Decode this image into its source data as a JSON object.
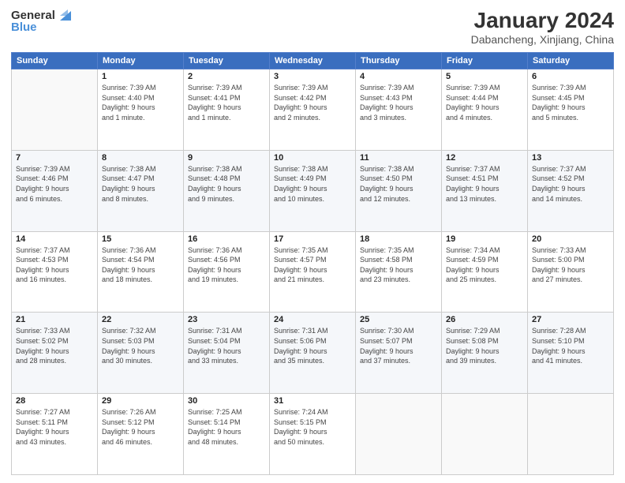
{
  "logo": {
    "line1": "General",
    "line2": "Blue"
  },
  "header": {
    "month": "January 2024",
    "location": "Dabancheng, Xinjiang, China"
  },
  "weekdays": [
    "Sunday",
    "Monday",
    "Tuesday",
    "Wednesday",
    "Thursday",
    "Friday",
    "Saturday"
  ],
  "weeks": [
    [
      {
        "day": "",
        "info": ""
      },
      {
        "day": "1",
        "info": "Sunrise: 7:39 AM\nSunset: 4:40 PM\nDaylight: 9 hours\nand 1 minute."
      },
      {
        "day": "2",
        "info": "Sunrise: 7:39 AM\nSunset: 4:41 PM\nDaylight: 9 hours\nand 1 minute."
      },
      {
        "day": "3",
        "info": "Sunrise: 7:39 AM\nSunset: 4:42 PM\nDaylight: 9 hours\nand 2 minutes."
      },
      {
        "day": "4",
        "info": "Sunrise: 7:39 AM\nSunset: 4:43 PM\nDaylight: 9 hours\nand 3 minutes."
      },
      {
        "day": "5",
        "info": "Sunrise: 7:39 AM\nSunset: 4:44 PM\nDaylight: 9 hours\nand 4 minutes."
      },
      {
        "day": "6",
        "info": "Sunrise: 7:39 AM\nSunset: 4:45 PM\nDaylight: 9 hours\nand 5 minutes."
      }
    ],
    [
      {
        "day": "7",
        "info": "Sunrise: 7:39 AM\nSunset: 4:46 PM\nDaylight: 9 hours\nand 6 minutes."
      },
      {
        "day": "8",
        "info": "Sunrise: 7:38 AM\nSunset: 4:47 PM\nDaylight: 9 hours\nand 8 minutes."
      },
      {
        "day": "9",
        "info": "Sunrise: 7:38 AM\nSunset: 4:48 PM\nDaylight: 9 hours\nand 9 minutes."
      },
      {
        "day": "10",
        "info": "Sunrise: 7:38 AM\nSunset: 4:49 PM\nDaylight: 9 hours\nand 10 minutes."
      },
      {
        "day": "11",
        "info": "Sunrise: 7:38 AM\nSunset: 4:50 PM\nDaylight: 9 hours\nand 12 minutes."
      },
      {
        "day": "12",
        "info": "Sunrise: 7:37 AM\nSunset: 4:51 PM\nDaylight: 9 hours\nand 13 minutes."
      },
      {
        "day": "13",
        "info": "Sunrise: 7:37 AM\nSunset: 4:52 PM\nDaylight: 9 hours\nand 14 minutes."
      }
    ],
    [
      {
        "day": "14",
        "info": "Sunrise: 7:37 AM\nSunset: 4:53 PM\nDaylight: 9 hours\nand 16 minutes."
      },
      {
        "day": "15",
        "info": "Sunrise: 7:36 AM\nSunset: 4:54 PM\nDaylight: 9 hours\nand 18 minutes."
      },
      {
        "day": "16",
        "info": "Sunrise: 7:36 AM\nSunset: 4:56 PM\nDaylight: 9 hours\nand 19 minutes."
      },
      {
        "day": "17",
        "info": "Sunrise: 7:35 AM\nSunset: 4:57 PM\nDaylight: 9 hours\nand 21 minutes."
      },
      {
        "day": "18",
        "info": "Sunrise: 7:35 AM\nSunset: 4:58 PM\nDaylight: 9 hours\nand 23 minutes."
      },
      {
        "day": "19",
        "info": "Sunrise: 7:34 AM\nSunset: 4:59 PM\nDaylight: 9 hours\nand 25 minutes."
      },
      {
        "day": "20",
        "info": "Sunrise: 7:33 AM\nSunset: 5:00 PM\nDaylight: 9 hours\nand 27 minutes."
      }
    ],
    [
      {
        "day": "21",
        "info": "Sunrise: 7:33 AM\nSunset: 5:02 PM\nDaylight: 9 hours\nand 28 minutes."
      },
      {
        "day": "22",
        "info": "Sunrise: 7:32 AM\nSunset: 5:03 PM\nDaylight: 9 hours\nand 30 minutes."
      },
      {
        "day": "23",
        "info": "Sunrise: 7:31 AM\nSunset: 5:04 PM\nDaylight: 9 hours\nand 33 minutes."
      },
      {
        "day": "24",
        "info": "Sunrise: 7:31 AM\nSunset: 5:06 PM\nDaylight: 9 hours\nand 35 minutes."
      },
      {
        "day": "25",
        "info": "Sunrise: 7:30 AM\nSunset: 5:07 PM\nDaylight: 9 hours\nand 37 minutes."
      },
      {
        "day": "26",
        "info": "Sunrise: 7:29 AM\nSunset: 5:08 PM\nDaylight: 9 hours\nand 39 minutes."
      },
      {
        "day": "27",
        "info": "Sunrise: 7:28 AM\nSunset: 5:10 PM\nDaylight: 9 hours\nand 41 minutes."
      }
    ],
    [
      {
        "day": "28",
        "info": "Sunrise: 7:27 AM\nSunset: 5:11 PM\nDaylight: 9 hours\nand 43 minutes."
      },
      {
        "day": "29",
        "info": "Sunrise: 7:26 AM\nSunset: 5:12 PM\nDaylight: 9 hours\nand 46 minutes."
      },
      {
        "day": "30",
        "info": "Sunrise: 7:25 AM\nSunset: 5:14 PM\nDaylight: 9 hours\nand 48 minutes."
      },
      {
        "day": "31",
        "info": "Sunrise: 7:24 AM\nSunset: 5:15 PM\nDaylight: 9 hours\nand 50 minutes."
      },
      {
        "day": "",
        "info": ""
      },
      {
        "day": "",
        "info": ""
      },
      {
        "day": "",
        "info": ""
      }
    ]
  ]
}
